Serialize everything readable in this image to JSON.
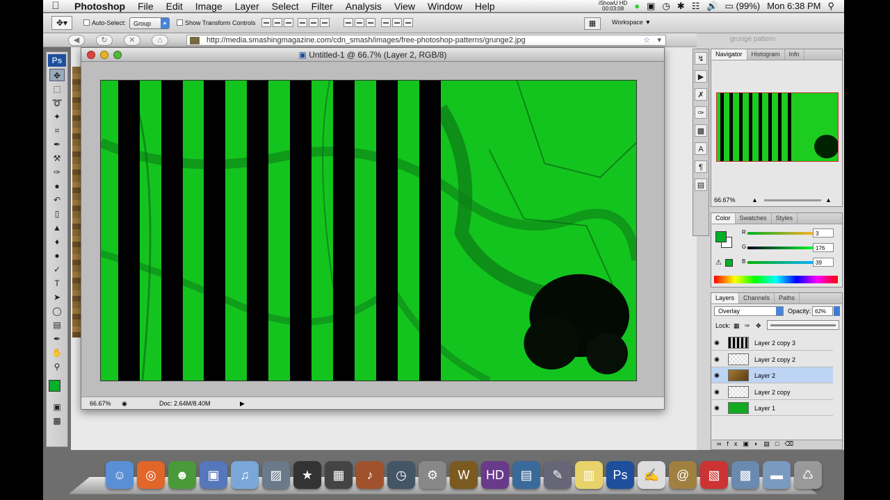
{
  "menubar": {
    "app_name": "Photoshop",
    "items": [
      "File",
      "Edit",
      "Image",
      "Layer",
      "Select",
      "Filter",
      "Analysis",
      "View",
      "Window",
      "Help"
    ],
    "recorder_line1": "iShowU HD",
    "recorder_line2": "00:03:08",
    "battery": "(99%)",
    "clock": "Mon 6:38 PM"
  },
  "options_bar": {
    "auto_select_label": "Auto-Select:",
    "auto_select_value": "Group",
    "transform_label": "Show Transform Controls",
    "workspace_label": "Workspace"
  },
  "browser": {
    "url": "http://media.smashingmagazine.com/cdn_smash/images/free-photoshop-patterns/grunge2.jpg",
    "bg_title": "grunge pattern"
  },
  "tools": {
    "logo": "Ps",
    "foreground_color": "#03b027"
  },
  "document": {
    "title": "Untitled-1 @ 66.7% (Layer 2, RGB/8)",
    "zoom": "66.67%",
    "doc_size": "Doc: 2.64M/8.40M",
    "canvas_color": "#14c41e",
    "stripe_color": "#000000"
  },
  "navigator": {
    "tabs": [
      "Navigator",
      "Histogram",
      "Info"
    ],
    "zoom": "66.67%"
  },
  "color_panel": {
    "tabs": [
      "Color",
      "Swatches",
      "Styles"
    ],
    "channels": [
      {
        "label": "R",
        "value": "3"
      },
      {
        "label": "G",
        "value": "176"
      },
      {
        "label": "B",
        "value": "39"
      }
    ]
  },
  "layers_panel": {
    "tabs": [
      "Layers",
      "Channels",
      "Paths"
    ],
    "blend_mode": "Overlay",
    "opacity_label": "Opacity:",
    "opacity_value": "62%",
    "lock_label": "Lock:",
    "layers": [
      {
        "name": "Layer 2 copy 3",
        "selected": false
      },
      {
        "name": "Layer 2 copy 2",
        "selected": false
      },
      {
        "name": "Layer 2",
        "selected": true
      },
      {
        "name": "Layer 2 copy",
        "selected": false
      },
      {
        "name": "Layer 1",
        "selected": false
      }
    ]
  },
  "dock": {
    "apps": [
      "finder-icon",
      "firefox-icon",
      "ichat-icon",
      "facetime-icon",
      "itunes-icon",
      "iphoto-icon",
      "imovie-star-icon",
      "clapper-icon",
      "guitar-icon",
      "time-machine-icon",
      "system-preferences-icon",
      "warcraft-icon",
      "hd-icon",
      "preview-icon",
      "pen-icon",
      "stickies-icon",
      "photoshop-icon",
      "textedit-icon",
      "address-book-icon",
      "pdf-icon",
      "movies-folder-icon",
      "folder-icon",
      "trash-icon"
    ]
  }
}
